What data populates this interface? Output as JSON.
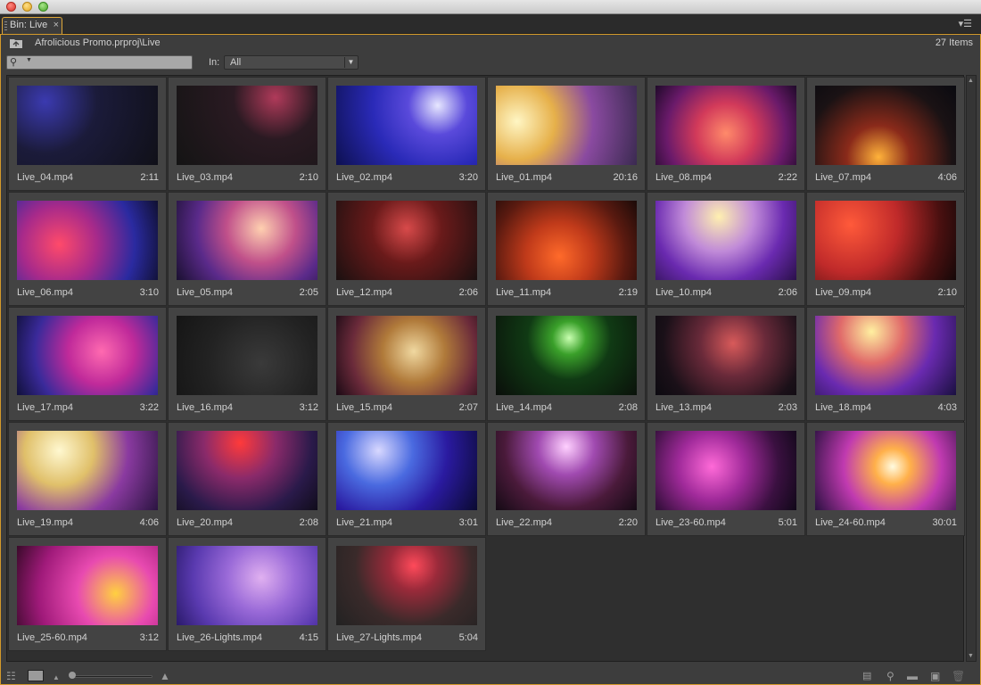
{
  "tab": {
    "label": "Bin: Live",
    "close": "×"
  },
  "path": {
    "text": "Afrolicious Promo.prproj\\Live",
    "items": "27 Items"
  },
  "filter": {
    "label": "In:",
    "value": "All"
  },
  "clips": [
    {
      "name": "Live_04.mp4",
      "dur": "2:11",
      "bg": "radial-gradient(circle at 20% 20%, #3b3ab0 0%, #1b1b3a 40%, #101018 100%)"
    },
    {
      "name": "Live_03.mp4",
      "dur": "2:10",
      "bg": "radial-gradient(circle at 70% 15%, #b03a5a 0%, #2a1a22 35%, #141414 100%)"
    },
    {
      "name": "Live_02.mp4",
      "dur": "3:20",
      "bg": "radial-gradient(circle at 72% 25%, #e7e7ff 0%, #5a4adb 25%, #2a2ab8 55%, #0d1050 100%)"
    },
    {
      "name": "Live_01.mp4",
      "dur": "20:16",
      "bg": "radial-gradient(circle at 15% 45%, #fff6c4 0%, #e6b04a 30%, #8a4aa0 60%, #3a2a50 100%)"
    },
    {
      "name": "Live_08.mp4",
      "dur": "2:22",
      "bg": "radial-gradient(circle at 50% 60%, #ff8a6a 0%, #d23a5a 35%, #6a1a6a 70%, #200a2a 100%)"
    },
    {
      "name": "Live_07.mp4",
      "dur": "4:06",
      "bg": "radial-gradient(circle at 45% 90%, #ffb23a 0%, #8a2a1a 30%, #1a1214 70%, #0a0a10 100%)"
    },
    {
      "name": "Live_06.mp4",
      "dur": "3:10",
      "bg": "radial-gradient(circle at 30% 55%, #ff4a6a 0%, #a82a8a 35%, #2a2aa0 70%, #101030 100%)"
    },
    {
      "name": "Live_05.mp4",
      "dur": "2:05",
      "bg": "radial-gradient(circle at 60% 35%, #ffd0b0 0%, #c0508a 35%, #5a2a8a 65%, #1a1030 100%)"
    },
    {
      "name": "Live_12.mp4",
      "dur": "2:06",
      "bg": "radial-gradient(circle at 50% 35%, #d84a4a 0%, #6a1a1a 40%, #1a1010 100%)"
    },
    {
      "name": "Live_11.mp4",
      "dur": "2:19",
      "bg": "radial-gradient(circle at 45% 70%, #ff6a2a 0%, #c03a1a 35%, #5a1a10 70%, #1a0a08 100%)"
    },
    {
      "name": "Live_10.mp4",
      "dur": "2:06",
      "bg": "radial-gradient(circle at 45% 20%, #fff0b0 0%, #c08ad8 35%, #6a2ab0 65%, #2a104a 100%)"
    },
    {
      "name": "Live_09.mp4",
      "dur": "2:10",
      "bg": "radial-gradient(circle at 25% 30%, #ff5a3a 0%, #c02a2a 40%, #4a1010 75%, #140808 100%)"
    },
    {
      "name": "Live_17.mp4",
      "dur": "3:22",
      "bg": "radial-gradient(circle at 60% 45%, #ff6ab0 0%, #c02a9a 35%, #3a2a9a 70%, #10103a 100%)"
    },
    {
      "name": "Live_16.mp4",
      "dur": "3:12",
      "bg": "radial-gradient(circle at 60% 60%, #3a3a3a 0%, #222222 55%, #151515 100%)"
    },
    {
      "name": "Live_15.mp4",
      "dur": "2:07",
      "bg": "radial-gradient(circle at 55% 45%, #f0d8a0 0%, #b07a3a 35%, #6a2a3a 70%, #1a0a14 100%)"
    },
    {
      "name": "Live_14.mp4",
      "dur": "2:08",
      "bg": "radial-gradient(circle at 52% 28%, #c8ffb0 0%, #3aa02a 18%, #103a14 45%, #0a0e0a 100%)"
    },
    {
      "name": "Live_13.mp4",
      "dur": "2:03",
      "bg": "radial-gradient(circle at 55% 35%, #d85a5a 0%, #6a2a3a 35%, #1a1018 75%, #0c0a10 100%)"
    },
    {
      "name": "Live_18.mp4",
      "dur": "4:03",
      "bg": "radial-gradient(circle at 40% 20%, #fff0a0 0%, #e06a6a 30%, #6a2ab0 60%, #1a1040 100%)"
    },
    {
      "name": "Live_19.mp4",
      "dur": "4:06",
      "bg": "radial-gradient(circle at 30% 25%, #fff8d0 0%, #e0c06a 30%, #8a3aa0 60%, #2a1440 100%)"
    },
    {
      "name": "Live_20.mp4",
      "dur": "2:08",
      "bg": "radial-gradient(circle at 45% 15%, #ff3a3a 0%, #8a2a6a 35%, #2a1a4a 70%, #100c1a 100%)"
    },
    {
      "name": "Live_21.mp4",
      "dur": "3:01",
      "bg": "radial-gradient(circle at 30% 25%, #d8d8ff 0%, #4a6ae0 30%, #2a1aa0 60%, #0a0a30 100%)"
    },
    {
      "name": "Live_22.mp4",
      "dur": "2:20",
      "bg": "radial-gradient(circle at 50% 20%, #ffd0ff 0%, #a04ab0 30%, #4a1a3a 65%, #140a14 100%)"
    },
    {
      "name": "Live_23-60.mp4",
      "dur": "5:01",
      "bg": "radial-gradient(circle at 40% 45%, #ff6ad8 0%, #a02a9a 35%, #3a1040 70%, #100818 100%)"
    },
    {
      "name": "Live_24-60.mp4",
      "dur": "30:01",
      "bg": "radial-gradient(circle at 55% 45%, #fffbe0 0%, #ffb04a 20%, #c03ab0 55%, #2a1040 100%)"
    },
    {
      "name": "Live_25-60.mp4",
      "dur": "3:12",
      "bg": "radial-gradient(circle at 70% 60%, #ffd040 0%, #e84ab0 35%, #a01a7a 70%, #3a0a2a 100%)"
    },
    {
      "name": "Live_26-Lights.mp4",
      "dur": "4:15",
      "bg": "radial-gradient(circle at 60% 40%, #e0b0f0 0%, #9a6ad8 35%, #5a3ab0 70%, #2a1a6a 100%)"
    },
    {
      "name": "Live_27-Lights.mp4",
      "dur": "5:04",
      "bg": "radial-gradient(circle at 55% 25%, #ff4a5a 0%, #9a2a3a 25%, #3a2a2a 60%, #222222 100%)"
    }
  ],
  "colors": {
    "panel": "#3d3d3d",
    "accent": "#d49a2a",
    "tile": "#434343"
  }
}
